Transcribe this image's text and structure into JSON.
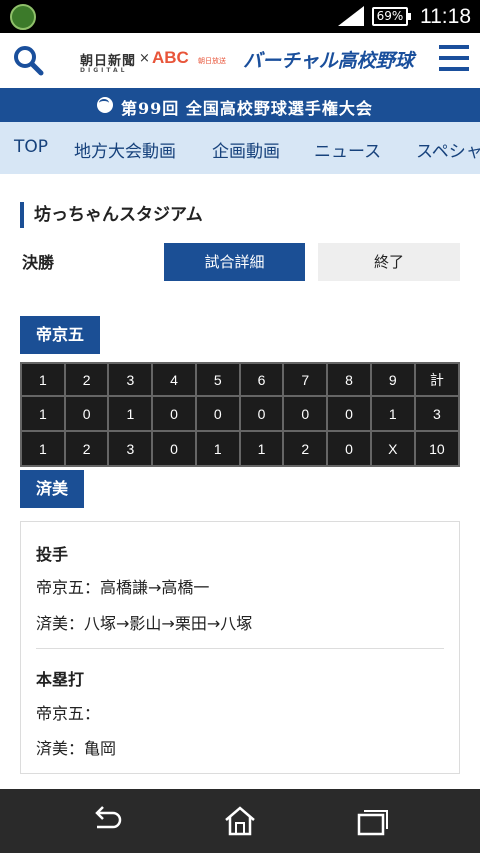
{
  "status_bar": {
    "network": "LTE",
    "battery": "69%",
    "time": "11:18"
  },
  "header": {
    "logo_asahi": "朝日新聞",
    "logo_asahi_sub": "DIGITAL",
    "cross": "×",
    "logo_abc": "ABC",
    "logo_abc_sub": "朝日放送",
    "brand": "バーチャル高校野球"
  },
  "banner": {
    "title": "第99回 全国高校野球選手権大会"
  },
  "nav": {
    "items": [
      "TOP",
      "地方大会動画",
      "企画動画",
      "ニュース",
      "スペシャ"
    ]
  },
  "game": {
    "venue": "坊っちゃんスタジアム",
    "round": "決勝",
    "detail_button": "試合詳細",
    "status": "終了"
  },
  "teams": {
    "top": "帝京五",
    "bottom": "済美"
  },
  "scoreboard": {
    "headers": [
      "1",
      "2",
      "3",
      "4",
      "5",
      "6",
      "7",
      "8",
      "9",
      "計"
    ],
    "rows": [
      [
        "1",
        "0",
        "1",
        "0",
        "0",
        "0",
        "0",
        "0",
        "1",
        "3"
      ],
      [
        "1",
        "2",
        "3",
        "0",
        "1",
        "1",
        "2",
        "0",
        "X",
        "10"
      ]
    ]
  },
  "details": {
    "pitchers_title": "投手",
    "pitchers_top": "帝京五：高橋謙→高橋一",
    "pitchers_bottom": "済美：八塚→影山→栗田→八塚",
    "homeruns_title": "本塁打",
    "homeruns_top": "帝京五：",
    "homeruns_bottom": "済美：亀岡"
  },
  "colors": {
    "accent": "#1b4f95",
    "nav_bg": "#d7e6f5",
    "score_bg": "#1c1c1c"
  }
}
